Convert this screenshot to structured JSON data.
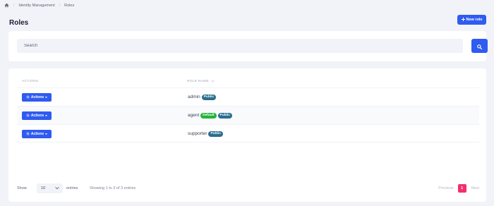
{
  "breadcrumb": {
    "home_icon": "home-icon",
    "items": [
      "Identity Management",
      "Roles"
    ]
  },
  "page": {
    "title": "Roles"
  },
  "toolbar": {
    "new_role_label": "New role",
    "new_role_icon": "plus-icon"
  },
  "search": {
    "placeholder": "Search",
    "button_icon": "search-icon"
  },
  "table": {
    "columns": [
      "ACTIONS",
      "ROLE NAME"
    ],
    "sort_icon": "chevron-down-icon",
    "action_label": "Actions",
    "rows": [
      {
        "name": "admin",
        "badges": [
          "Public"
        ]
      },
      {
        "name": "agent",
        "badges": [
          "Default",
          "Public"
        ]
      },
      {
        "name": "supporter",
        "badges": [
          "Public"
        ]
      }
    ]
  },
  "footer": {
    "show_label": "Show",
    "entries_value": "10",
    "entries_label": "entries",
    "info": "Showing 1 to 3 of 3 entries",
    "pagination": {
      "previous": "Previous",
      "current": "1",
      "next": "Next"
    }
  },
  "colors": {
    "primary": "#2f5bf0",
    "public_badge": "#2b6e8f",
    "default_badge": "#25b43c",
    "active_page": "#f1306c"
  }
}
